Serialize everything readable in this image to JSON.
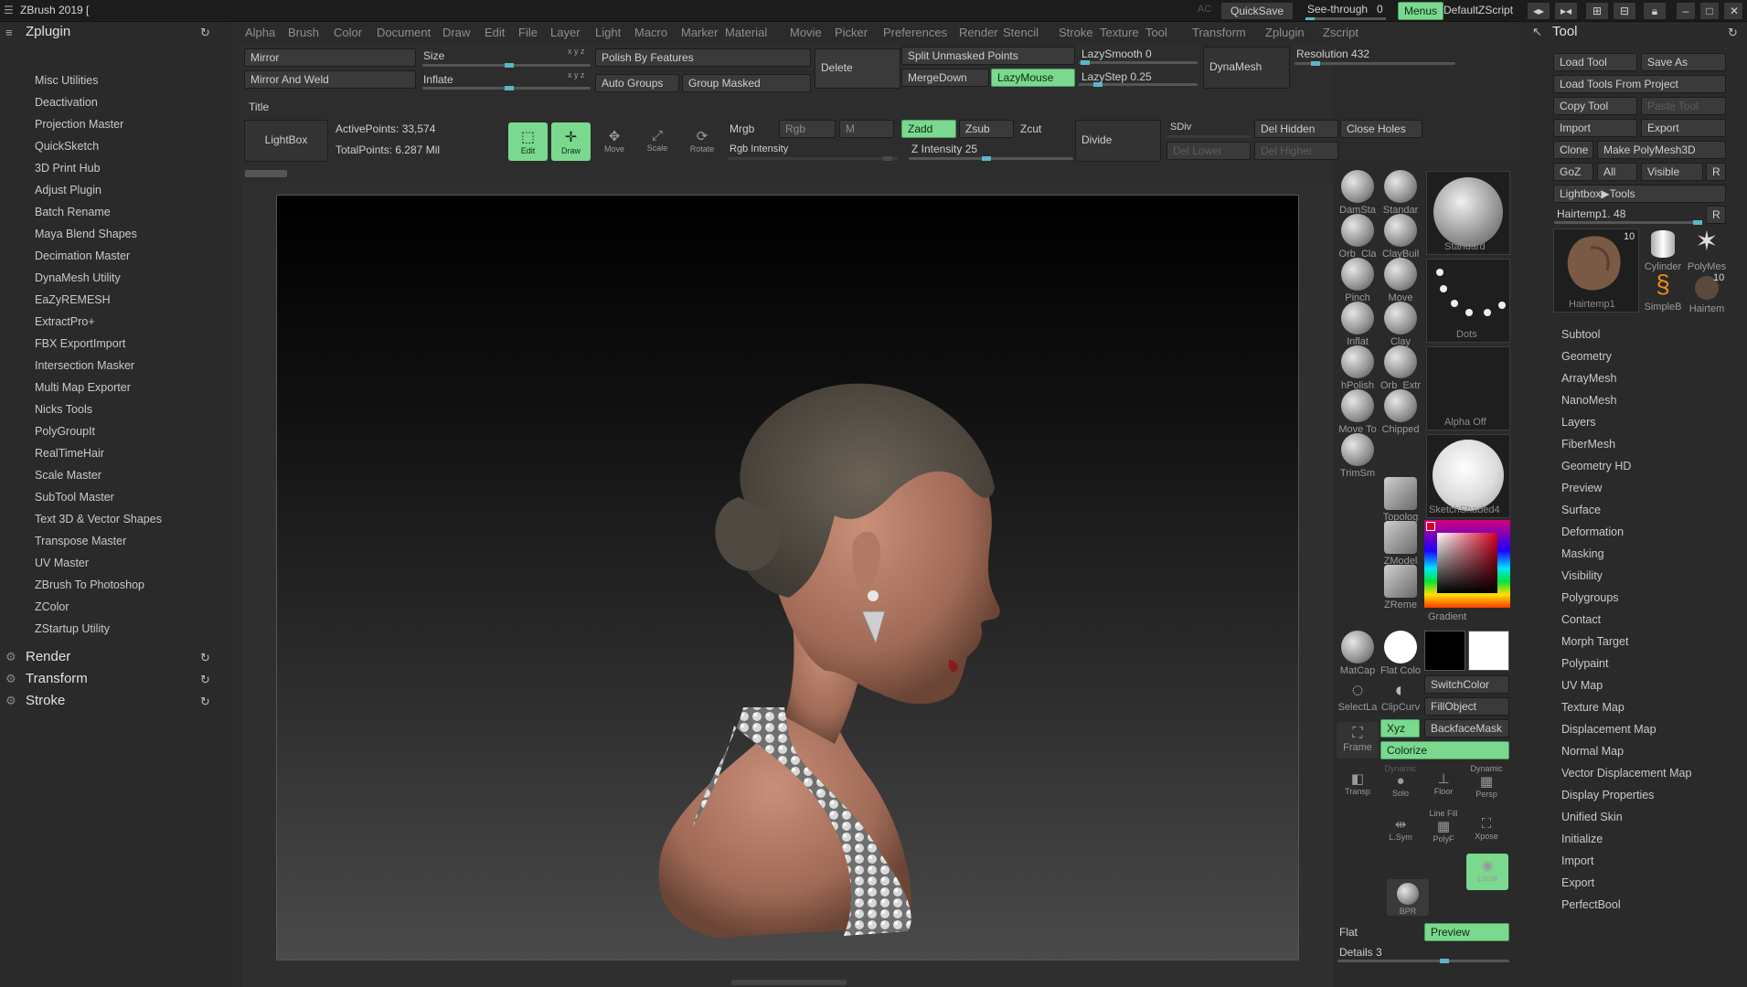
{
  "titlebar": {
    "title": "ZBrush 2019 [",
    "ac": "AC",
    "quicksave": "QuickSave",
    "seethrough": "See-through",
    "seethrough_val": "0",
    "menus": "Menus",
    "script": "DefaultZScript"
  },
  "menus": [
    "Alpha",
    "Brush",
    "Color",
    "Document",
    "Draw",
    "Edit",
    "File",
    "Layer",
    "Light",
    "Macro",
    "Marker",
    "Material",
    "Movie",
    "Picker",
    "Preferences",
    "Render",
    "Stencil",
    "Stroke",
    "Texture",
    "Tool",
    "Transform",
    "Zplugin",
    "Zscript"
  ],
  "left": {
    "header": "Zplugin",
    "items": [
      "Misc Utilities",
      "Deactivation",
      "Projection Master",
      "QuickSketch",
      "3D Print Hub",
      "Adjust Plugin",
      "Batch Rename",
      "Maya Blend Shapes",
      "Decimation Master",
      "DynaMesh Utility",
      "EaZyREMESH",
      "ExtractPro+",
      "FBX ExportImport",
      "Intersection Masker",
      "Multi Map Exporter",
      "Nicks Tools",
      "PolyGroupIt",
      "RealTimeHair",
      "Scale Master",
      "SubTool Master",
      "Text 3D & Vector Shapes",
      "Transpose Master",
      "UV Master",
      "ZBrush To Photoshop",
      "ZColor",
      "ZStartup Utility"
    ],
    "sections": [
      "Render",
      "Transform",
      "Stroke"
    ]
  },
  "shelf": {
    "mirror": "Mirror",
    "mirror_weld": "Mirror And Weld",
    "size": "Size",
    "inflate": "Inflate",
    "xyz1": "x y z",
    "xyz2": "x y z",
    "polish": "Polish By Features",
    "auto_groups": "Auto Groups",
    "group_masked": "Group Masked",
    "delete": "Delete",
    "split": "Split Unmasked Points",
    "mergedown": "MergeDown",
    "lazymouse": "LazyMouse",
    "lazysmooth": "LazySmooth 0",
    "lazystep": "LazyStep 0.25",
    "dynamesh": "DynaMesh",
    "resolution": "Resolution 432",
    "title": "Title",
    "lightbox": "LightBox",
    "active_points": "ActivePoints: 33,574",
    "total_points": "TotalPoints: 6.287 Mil",
    "edit": "Edit",
    "draw": "Draw",
    "move": "Move",
    "scale": "Scale",
    "rotate": "Rotate",
    "mrgb": "Mrgb",
    "rgb": "Rgb",
    "m": "M",
    "zadd": "Zadd",
    "zsub": "Zsub",
    "zcut": "Zcut",
    "rgb_intensity": "Rgb Intensity",
    "z_intensity": "Z Intensity 25",
    "divide": "Divide",
    "sdiv": "SDiv",
    "del_lower": "Del Lower",
    "del_higher": "Del Higher",
    "del_hidden": "Del Hidden",
    "close_holes": "Close Holes"
  },
  "brushes": [
    {
      "name": "DamSta",
      "icon": "damstandard-brush-icon"
    },
    {
      "name": "Standar",
      "icon": "standard-brush-icon"
    },
    {
      "name": "Orb_Cla",
      "icon": "orb-clay-brush-icon"
    },
    {
      "name": "ClayBuil",
      "icon": "claybuildup-brush-icon"
    },
    {
      "name": "Pinch",
      "icon": "pinch-brush-icon"
    },
    {
      "name": "Move",
      "icon": "move-brush-icon"
    },
    {
      "name": "Inflat",
      "icon": "inflate-brush-icon"
    },
    {
      "name": "Clay",
      "icon": "clay-brush-icon"
    },
    {
      "name": "hPolish",
      "icon": "hpolish-brush-icon"
    },
    {
      "name": "Orb_Extr",
      "icon": "orb-extrude-brush-icon"
    },
    {
      "name": "Move To",
      "icon": "move-topological-brush-icon"
    },
    {
      "name": "Chipped",
      "icon": "chipped-brush-icon"
    },
    {
      "name": "TrimSm",
      "icon": "trimsmooth-brush-icon"
    },
    {
      "name": "Topolog",
      "icon": "topology-brush-icon"
    },
    {
      "name": "ZModel",
      "icon": "zmodeler-brush-icon"
    },
    {
      "name": "ZReme",
      "icon": "zremesher-brush-icon"
    }
  ],
  "mid": {
    "standard": "Standard",
    "dots": "Dots",
    "alpha_off": "Alpha Off",
    "material": "SketchShaded4",
    "gradient": "Gradient",
    "matcap": "MatCap",
    "flat_color": "Flat Colo",
    "switch_color": "SwitchColor",
    "fill_object": "FillObject",
    "select_lasso": "SelectLa",
    "clip_curve": "ClipCurv",
    "xyz": "Xyz",
    "backface": "BackfaceMask",
    "colorize": "Colorize",
    "frame": "Frame",
    "transp": "Transp",
    "solo": "Solo",
    "floor": "Floor",
    "persp": "Persp",
    "dynamic": "Dynamic",
    "lsym": "L.Sym",
    "polyf": "PolyF",
    "xpose": "Xpose",
    "line_fill": "Line Fill",
    "local": "Local",
    "bpr": "BPR",
    "flat": "Flat",
    "preview": "Preview",
    "details": "Details 3",
    "colors": {
      "accent": "#7bd88f",
      "primary": "#000000",
      "secondary": "#ffffff"
    }
  },
  "right": {
    "header": "Tool",
    "load_tool": "Load Tool",
    "save_as": "Save As",
    "load_project": "Load Tools From Project",
    "copy_tool": "Copy Tool",
    "paste_tool": "Paste Tool",
    "import": "Import",
    "export": "Export",
    "clone": "Clone",
    "make_polymesh": "Make PolyMesh3D",
    "goz": "GoZ",
    "all": "All",
    "visible": "Visible",
    "r": "R",
    "lightbox_tools": "Lightbox▶Tools",
    "hairtemp": "Hairtemp1. 48",
    "r2": "R",
    "thumbs": [
      {
        "name": "Hairtemp1",
        "count": "10"
      },
      {
        "name": "Cylinder",
        "count": ""
      },
      {
        "name": "PolyMes",
        "count": ""
      },
      {
        "name": "SimpleB",
        "count": ""
      },
      {
        "name": "Hairtem",
        "count": "10"
      }
    ],
    "sections": [
      "Subtool",
      "Geometry",
      "ArrayMesh",
      "NanoMesh",
      "Layers",
      "FiberMesh",
      "Geometry HD",
      "Preview",
      "Surface",
      "Deformation",
      "Masking",
      "Visibility",
      "Polygroups",
      "Contact",
      "Morph Target",
      "Polypaint",
      "UV Map",
      "Texture Map",
      "Displacement Map",
      "Normal Map",
      "Vector Displacement Map",
      "Display Properties",
      "Unified Skin",
      "Initialize",
      "Import",
      "Export",
      "PerfectBool"
    ]
  }
}
